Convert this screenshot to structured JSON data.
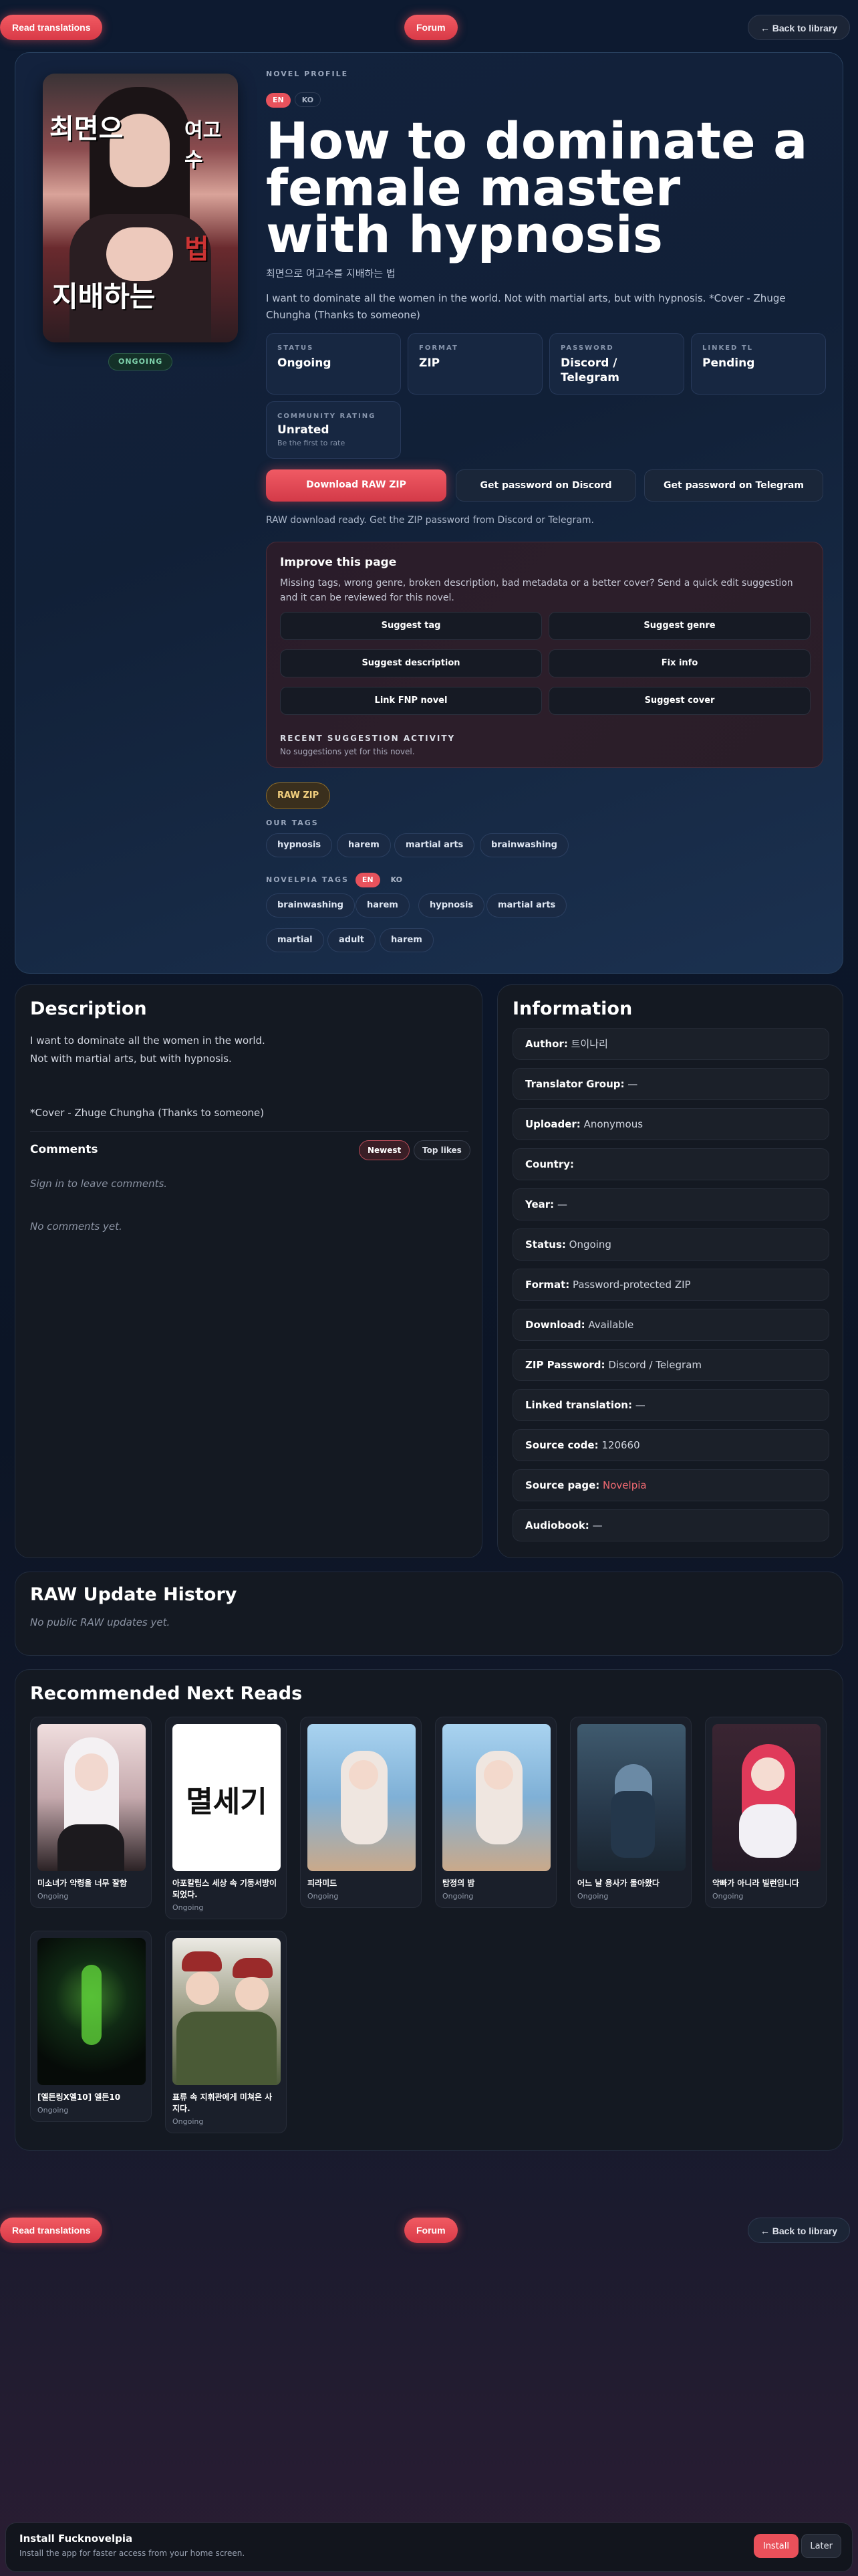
{
  "nav": {
    "read_translations": "Read translations",
    "forum": "Forum",
    "back_to_library": "← Back to library"
  },
  "hero": {
    "eyebrow": "NOVEL PROFILE",
    "lang_en": "EN",
    "lang_ko": "KO",
    "title": "How to dominate a female master with hypnosis",
    "subtitle": "최면으로 여고수를 지배하는 법",
    "synopsis": "I want to dominate all the women in the world. Not with martial arts, but with hypnosis. *Cover - Zhuge Chungha (Thanks to someone)",
    "status_badge": "ONGOING",
    "cover_text": [
      "최면으",
      "여고수",
      "지배하는",
      "법"
    ]
  },
  "stats": [
    {
      "label": "STATUS",
      "value": "Ongoing"
    },
    {
      "label": "FORMAT",
      "value": "ZIP"
    },
    {
      "label": "PASSWORD",
      "value": "Discord / Telegram"
    },
    {
      "label": "LINKED TL",
      "value": "Pending"
    },
    {
      "label": "COMMUNITY RATING",
      "value": "Unrated",
      "sub": "Be the first to rate"
    }
  ],
  "actions": {
    "download": "Download RAW ZIP",
    "discord": "Get password on Discord",
    "telegram": "Get password on Telegram",
    "note": "RAW download ready. Get the ZIP password from Discord or Telegram."
  },
  "improve": {
    "title": "Improve this page",
    "text": "Missing tags, wrong genre, broken description, bad metadata or a better cover? Send a quick edit suggestion and it can be reviewed for this novel.",
    "buttons": [
      "Suggest tag",
      "Suggest genre",
      "Suggest description",
      "Fix info",
      "Link FNP novel",
      "Suggest cover"
    ],
    "recent_label": "RECENT SUGGESTION ACTIVITY",
    "recent_text": "No suggestions yet for this novel."
  },
  "tags": {
    "raw_zip": "RAW ZIP",
    "our_tags_label": "OUR TAGS",
    "our_tags": [
      "hypnosis",
      "harem",
      "martial arts",
      "brainwashing"
    ],
    "novelpia_label": "NOVELPIA TAGS",
    "novelpia_tags": [
      "brainwashing",
      "harem",
      "hypnosis",
      "martial arts",
      "martial",
      "adult",
      "harem"
    ]
  },
  "description": {
    "title": "Description",
    "lines": [
      "I want to dominate all the women in the world.",
      "Not with martial arts, but with hypnosis.",
      "",
      "*Cover - Zhuge Chungha (Thanks to someone)"
    ],
    "comments_title": "Comments",
    "sort_newest": "Newest",
    "sort_top": "Top likes",
    "sign_in": "Sign in to leave comments.",
    "empty": "No comments yet."
  },
  "info": {
    "title": "Information",
    "rows": [
      {
        "k": "Author:",
        "v": "트이나리"
      },
      {
        "k": "Translator Group:",
        "v": "—"
      },
      {
        "k": "Uploader:",
        "v": "Anonymous"
      },
      {
        "k": "Country:",
        "v": ""
      },
      {
        "k": "Year:",
        "v": "—"
      },
      {
        "k": "Status:",
        "v": "Ongoing"
      },
      {
        "k": "Format:",
        "v": "Password-protected ZIP"
      },
      {
        "k": "Download:",
        "v": "Available"
      },
      {
        "k": "ZIP Password:",
        "v": "Discord / Telegram"
      },
      {
        "k": "Linked translation:",
        "v": "—"
      },
      {
        "k": "Source code:",
        "v": "120660"
      },
      {
        "k": "Source page:",
        "v": "Novelpia",
        "link": true
      },
      {
        "k": "Audiobook:",
        "v": "—"
      }
    ]
  },
  "history": {
    "title": "RAW Update History",
    "empty": "No public RAW updates yet."
  },
  "recommended": {
    "title": "Recommended Next Reads",
    "items": [
      {
        "name": "미소녀가 악령을 너무 잘함",
        "status": "Ongoing",
        "bg": "#d9c7c8"
      },
      {
        "name": "아포칼립스 세상 속 기둥서방이 되었다.",
        "status": "Ongoing",
        "bg": "#ffffff",
        "cover_word": "멸세기"
      },
      {
        "name": "피라미드",
        "status": "Ongoing",
        "bg": "#8fb7d6"
      },
      {
        "name": "탐정의 밤",
        "status": "Ongoing",
        "bg": "#8fb7d6"
      },
      {
        "name": "어느 날 용사가 돌아왔다",
        "status": "Ongoing",
        "bg": "#34485a"
      },
      {
        "name": "악빠가 아니라 빌런입니다",
        "status": "Ongoing",
        "bg": "#2b2131"
      },
      {
        "name": "[엘든링X엘10] 엘든10",
        "status": "Ongoing",
        "bg": "#0d1a12"
      },
      {
        "name": "표류 속 지휘관에게 미쳐은 사지다.",
        "status": "Ongoing",
        "bg": "#e9e6df"
      }
    ]
  },
  "install": {
    "title": "Install Fucknovelpia",
    "text": "Install the app for faster access from your home screen.",
    "install": "Install",
    "later": "Later"
  }
}
